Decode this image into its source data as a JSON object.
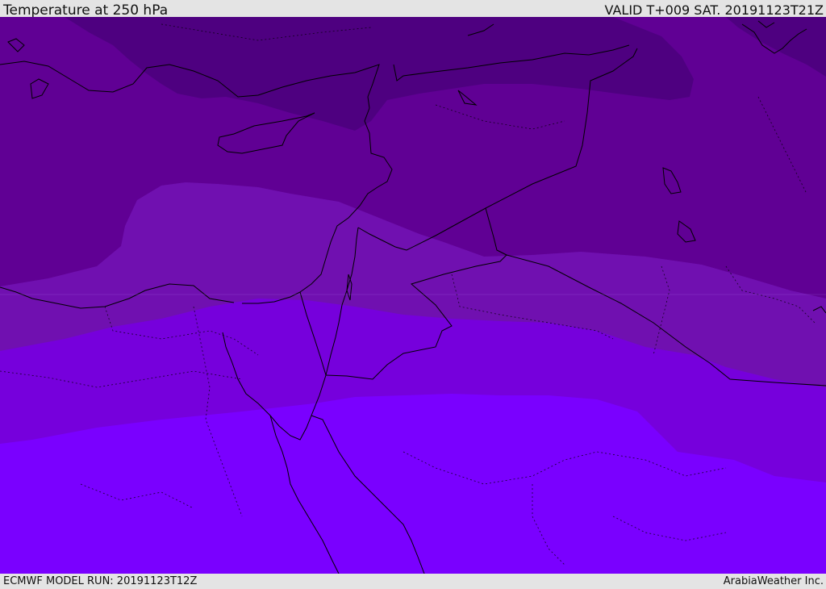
{
  "header": {
    "title": "Temperature at 250 hPa",
    "valid": "VALID T+009 SAT. 20191123T21Z"
  },
  "footer": {
    "model_run": "ECMWF MODEL RUN: 20191123T12Z",
    "credit": "ArabiaWeather Inc."
  },
  "map": {
    "region": "Eastern Mediterranean / Middle East",
    "colors": {
      "band_coldest": "#4e0080",
      "band_cold": "#600094",
      "band_mid_cold": "#7010b0",
      "band_mid": "#7600dc",
      "band_warm": "#7a00ff",
      "coastline": "#000000",
      "border": "#000000"
    }
  }
}
